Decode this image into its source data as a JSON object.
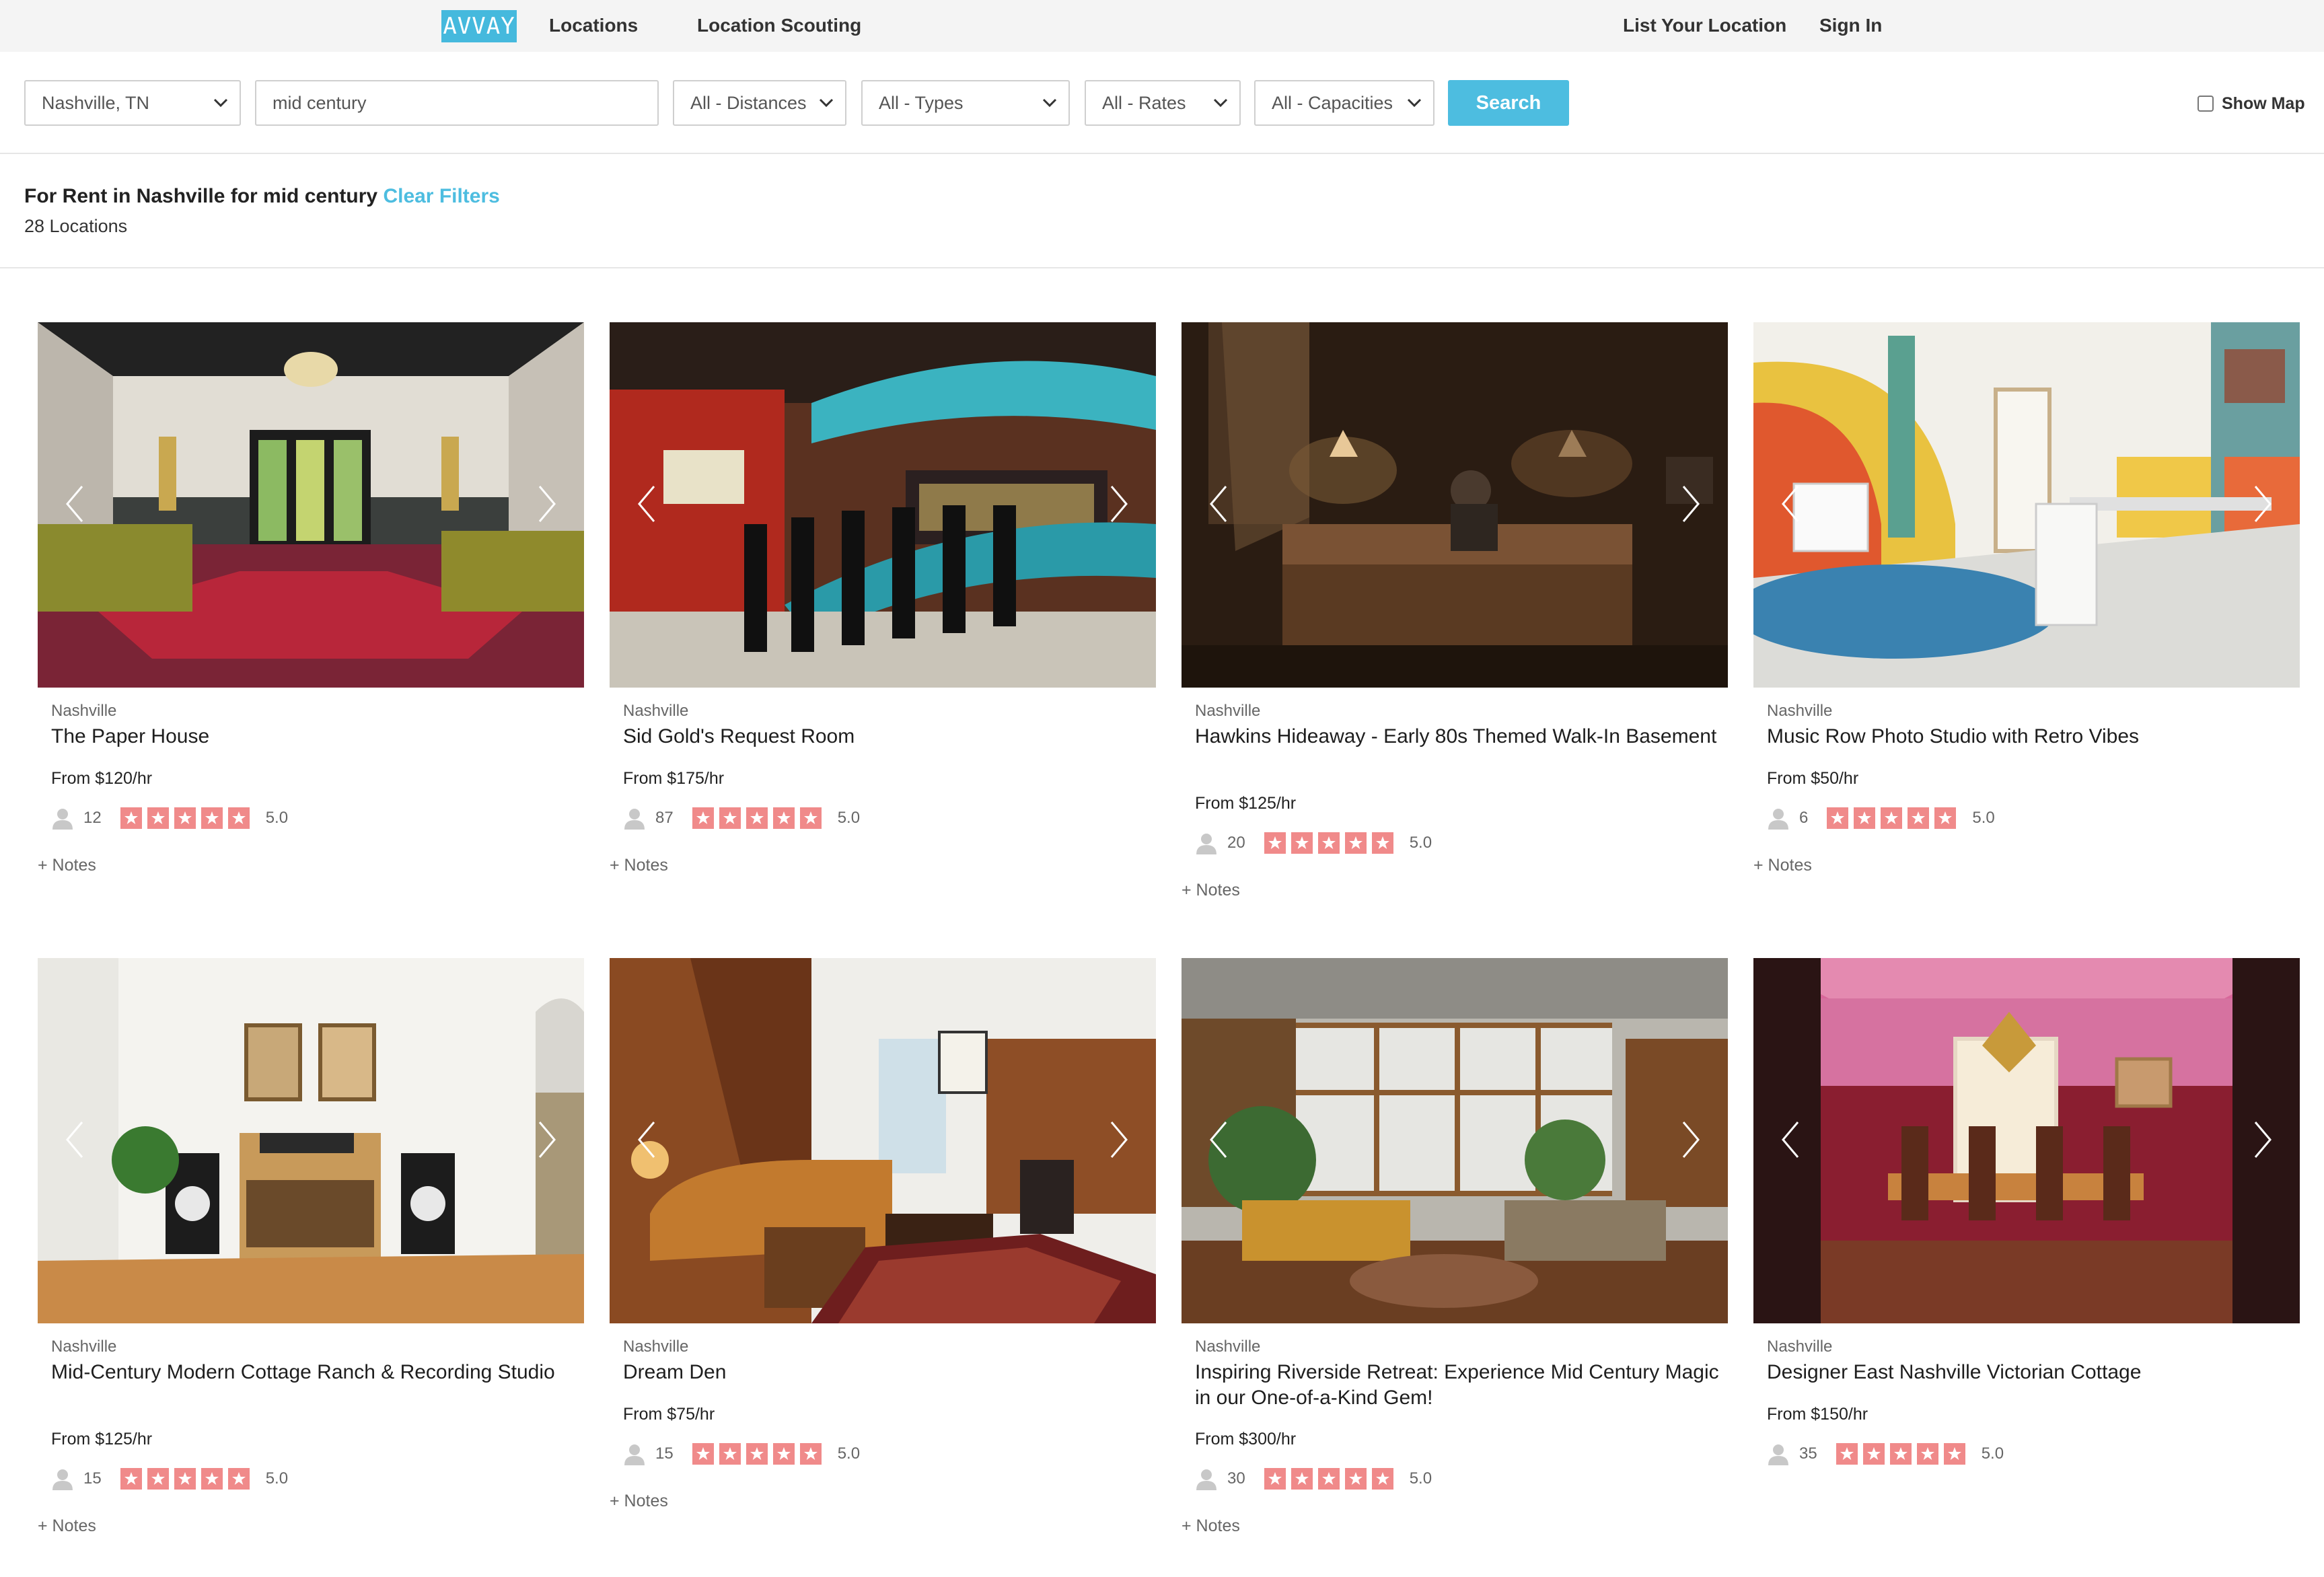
{
  "nav": {
    "logo": "AVVAY",
    "links": [
      "Locations",
      "Location Scouting"
    ],
    "right_links": [
      "List Your Location",
      "Sign In"
    ]
  },
  "search": {
    "city": "Nashville, TN",
    "keyword": "mid century",
    "distance": "All - Distances",
    "type": "All - Types",
    "rate": "All - Rates",
    "capacity": "All - Capacities",
    "button": "Search",
    "show_map": "Show Map"
  },
  "results": {
    "title": "For Rent in Nashville for mid century",
    "clear": "Clear Filters",
    "count": "28 Locations"
  },
  "listings": [
    {
      "city": "Nashville",
      "title": "The Paper House",
      "price": "From $120/hr",
      "capacity": "12",
      "rating": "5.0",
      "notes": "+ Notes"
    },
    {
      "city": "Nashville",
      "title": "Sid Gold's Request Room",
      "price": "From $175/hr",
      "capacity": "87",
      "rating": "5.0",
      "notes": "+ Notes"
    },
    {
      "city": "Nashville",
      "title": "Hawkins Hideaway - Early 80s Themed Walk-In Basement",
      "price": "From $125/hr",
      "capacity": "20",
      "rating": "5.0",
      "notes": "+ Notes"
    },
    {
      "city": "Nashville",
      "title": "Music Row Photo Studio with Retro Vibes",
      "price": "From $50/hr",
      "capacity": "6",
      "rating": "5.0",
      "notes": "+ Notes"
    },
    {
      "city": "Nashville",
      "title": "Mid-Century Modern Cottage Ranch & Recording Studio",
      "price": "From $125/hr",
      "capacity": "15",
      "rating": "5.0",
      "notes": "+ Notes"
    },
    {
      "city": "Nashville",
      "title": "Dream Den",
      "price": "From $75/hr",
      "capacity": "15",
      "rating": "5.0",
      "notes": "+ Notes"
    },
    {
      "city": "Nashville",
      "title": "Inspiring Riverside Retreat: Experience Mid Century Magic in our One-of-a-Kind Gem!",
      "price": "From $300/hr",
      "capacity": "30",
      "rating": "5.0",
      "notes": "+ Notes"
    },
    {
      "city": "Nashville",
      "title": "Designer East Nashville Victorian Cottage",
      "price": "From $150/hr",
      "capacity": "35",
      "rating": "5.0",
      "notes": ""
    }
  ]
}
